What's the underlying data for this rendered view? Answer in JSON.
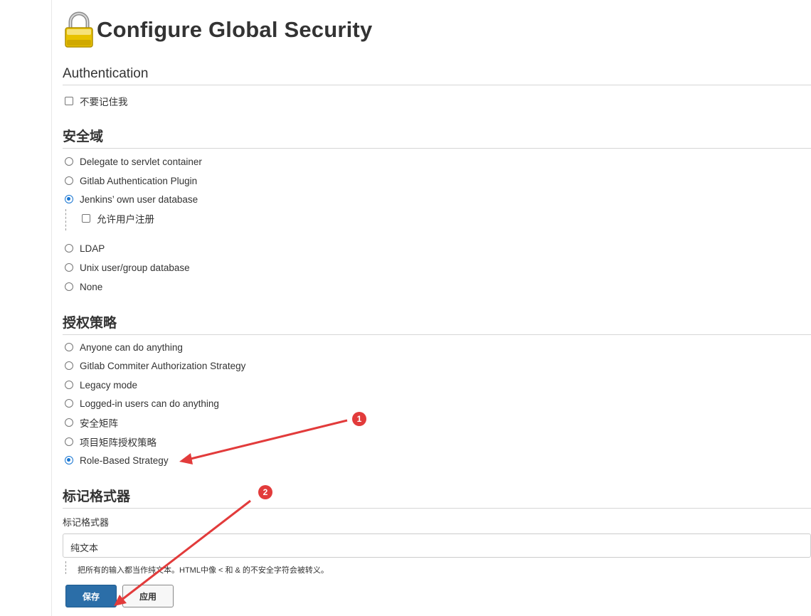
{
  "page": {
    "title": "Configure Global Security"
  },
  "authentication": {
    "header": "Authentication",
    "remember_me_label": "不要记住我"
  },
  "security_realm": {
    "header": "安全域",
    "options": [
      {
        "label": "Delegate to servlet container",
        "checked": false
      },
      {
        "label": "Gitlab Authentication Plugin",
        "checked": false
      },
      {
        "label": "Jenkins’ own user database",
        "checked": true
      },
      {
        "label": "LDAP",
        "checked": false
      },
      {
        "label": "Unix user/group database",
        "checked": false
      },
      {
        "label": "None",
        "checked": false
      }
    ],
    "allow_signup_label": "允许用户注册"
  },
  "authorization": {
    "header": "授权策略",
    "options": [
      {
        "label": "Anyone can do anything",
        "checked": false
      },
      {
        "label": "Gitlab Commiter Authorization Strategy",
        "checked": false
      },
      {
        "label": "Legacy mode",
        "checked": false
      },
      {
        "label": "Logged-in users can do anything",
        "checked": false
      },
      {
        "label": "安全矩阵",
        "checked": false
      },
      {
        "label": "项目矩阵授权策略",
        "checked": false
      },
      {
        "label": "Role-Based Strategy",
        "checked": true
      }
    ]
  },
  "markup_formatter": {
    "header": "标记格式器",
    "field_label": "标记格式器",
    "selected_value": "纯文本",
    "help_text": "把所有的输入都当作纯文本。HTML中像 < 和 & 的不安全字符会被转义。"
  },
  "buttons": {
    "save_label": "保存",
    "apply_label": "应用"
  },
  "annotations": {
    "badge_1": "1",
    "badge_2": "2",
    "color": "#e23b3b"
  },
  "colors": {
    "primary_button": "#2b6ea8",
    "radio_checked": "#1976d2"
  }
}
